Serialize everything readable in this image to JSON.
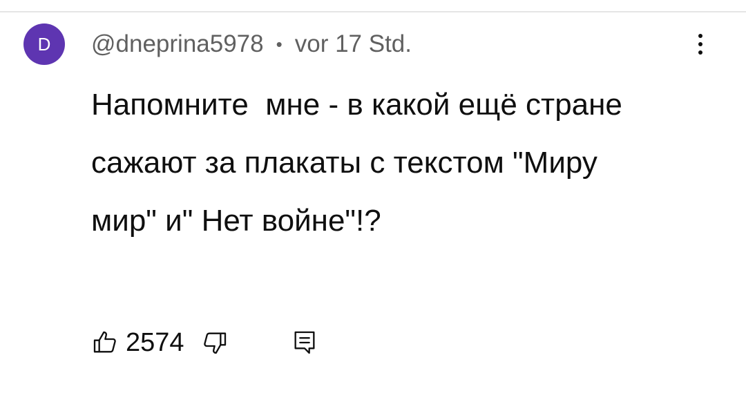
{
  "comment": {
    "avatar_letter": "D",
    "avatar_color": "#5e35b1",
    "username": "@dneprina5978",
    "separator": "•",
    "timestamp": "vor 17 Std.",
    "text": "Напомните  мне - в какой ещё стране сажают за плакаты с текстом \"Миру мир\" и\" Нет войне\"!?",
    "like_count": "2574"
  },
  "icons": {
    "more": "more-vert-icon",
    "like": "thumb-up-icon",
    "dislike": "thumb-down-icon",
    "reply": "comment-reply-icon"
  }
}
